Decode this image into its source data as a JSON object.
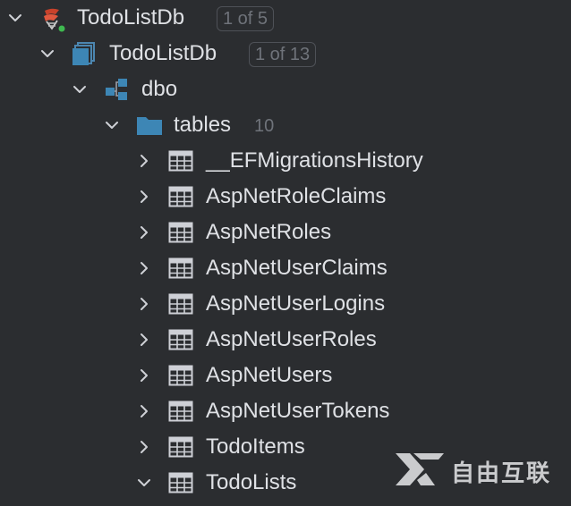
{
  "tree": {
    "root": {
      "label": "TodoListDb",
      "badge": "1 of 5",
      "icon": "sqlserver-datasource-icon",
      "status_color": "#3fb950"
    },
    "database": {
      "label": "TodoListDb",
      "badge": "1 of 13",
      "icon": "database-icon"
    },
    "schema": {
      "label": "dbo",
      "icon": "schema-icon"
    },
    "tables_folder": {
      "label": "tables",
      "count": "10",
      "icon": "folder-icon"
    },
    "tables": [
      {
        "label": "__EFMigrationsHistory",
        "expanded": false
      },
      {
        "label": "AspNetRoleClaims",
        "expanded": false
      },
      {
        "label": "AspNetRoles",
        "expanded": false
      },
      {
        "label": "AspNetUserClaims",
        "expanded": false
      },
      {
        "label": "AspNetUserLogins",
        "expanded": false
      },
      {
        "label": "AspNetUserRoles",
        "expanded": false
      },
      {
        "label": "AspNetUsers",
        "expanded": false
      },
      {
        "label": "AspNetUserTokens",
        "expanded": false
      },
      {
        "label": "TodoItems",
        "expanded": false
      },
      {
        "label": "TodoLists",
        "expanded": true
      }
    ]
  },
  "watermark": {
    "text": "自由互联"
  },
  "colors": {
    "background": "#2b2d30",
    "text": "#dfe1e5",
    "muted": "#6f737a",
    "folder_blue": "#3d86b5",
    "table_gray": "#ced0d6"
  }
}
